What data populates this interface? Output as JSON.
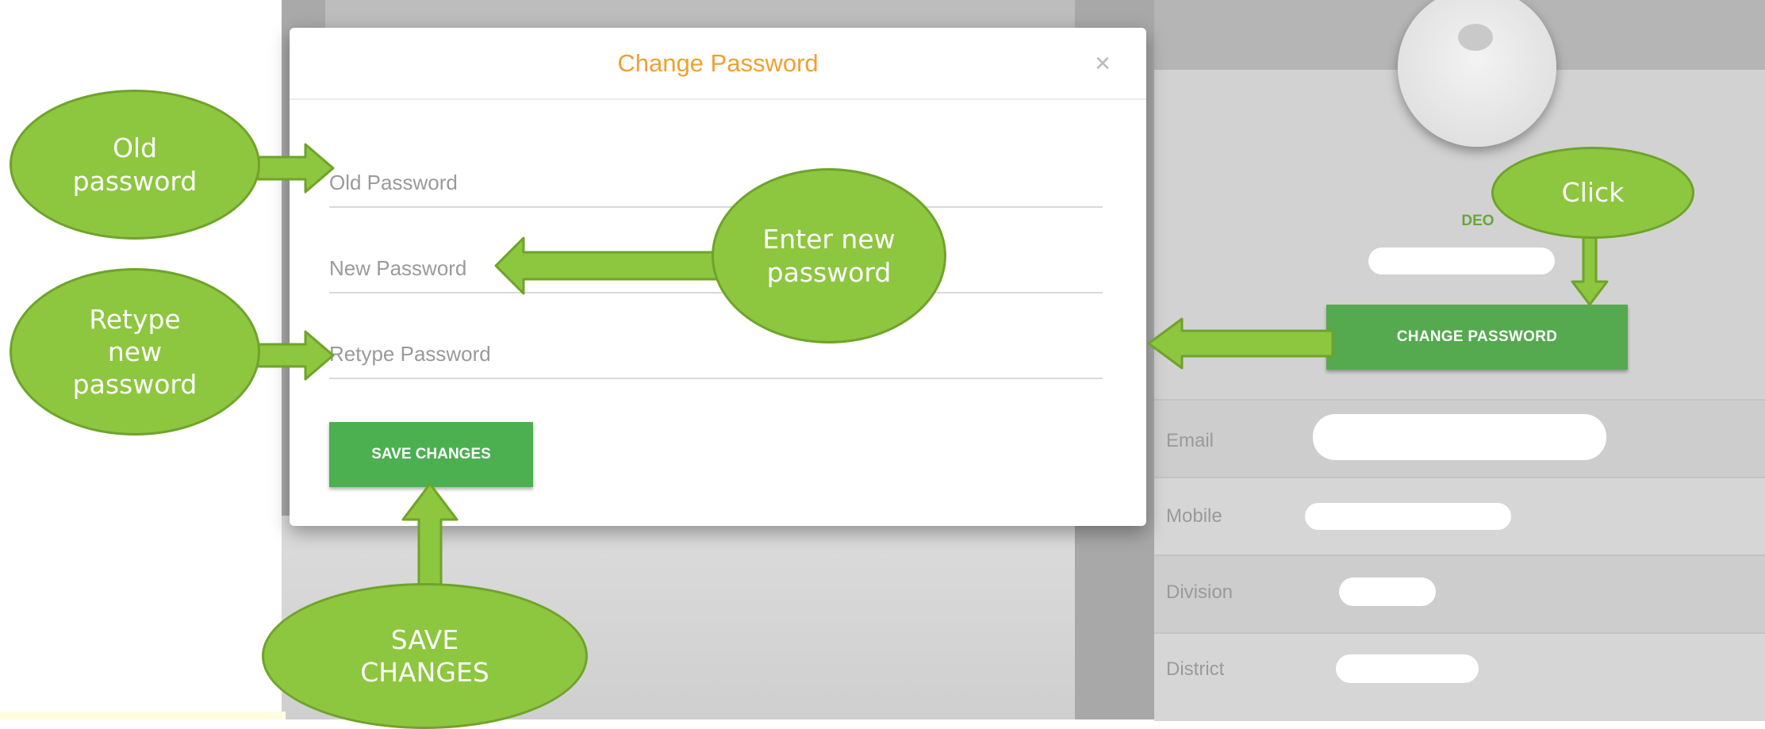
{
  "modal": {
    "title": "Change Password",
    "close_glyph": "×",
    "fields": {
      "old_password_placeholder": "Old Password",
      "new_password_placeholder": "New Password",
      "retype_password_placeholder": "Retype Password"
    },
    "save_label": "SAVE CHANGES"
  },
  "profile": {
    "role": "DEO",
    "change_password_label": "CHANGE PASSWORD",
    "rows": [
      {
        "label": "Email"
      },
      {
        "label": "Mobile"
      },
      {
        "label": "Division"
      },
      {
        "label": "District"
      }
    ]
  },
  "annotations": {
    "old_password": "Old\npassword",
    "enter_new_password": "Enter new\npassword",
    "retype_new_password": "Retype\nnew\npassword",
    "save_changes": "SAVE\nCHANGES",
    "click": "Click"
  },
  "colors": {
    "annotation_green": "#8dc63f",
    "button_green": "#4caf50",
    "title_orange": "#f0a030"
  }
}
